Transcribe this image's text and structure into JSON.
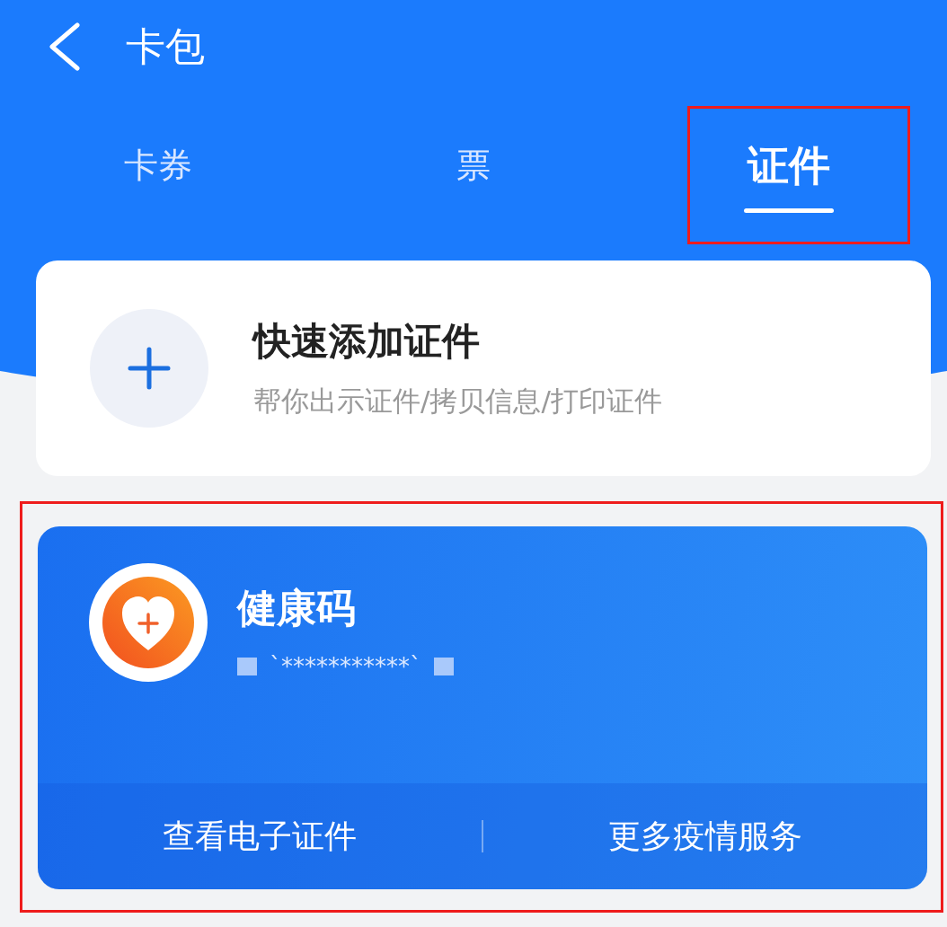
{
  "header": {
    "title": "卡包"
  },
  "tabs": [
    {
      "label": "卡券",
      "selected": false,
      "highlighted": false
    },
    {
      "label": "票",
      "selected": false,
      "highlighted": false
    },
    {
      "label": "证件",
      "selected": true,
      "highlighted": true
    }
  ],
  "add_card": {
    "title": "快速添加证件",
    "subtitle": "帮你出示证件/拷贝信息/打印证件"
  },
  "health_card": {
    "title": "健康码",
    "masked_id": "`***********`",
    "highlighted": true,
    "actions": [
      "查看电子证件",
      "更多疫情服务"
    ]
  }
}
